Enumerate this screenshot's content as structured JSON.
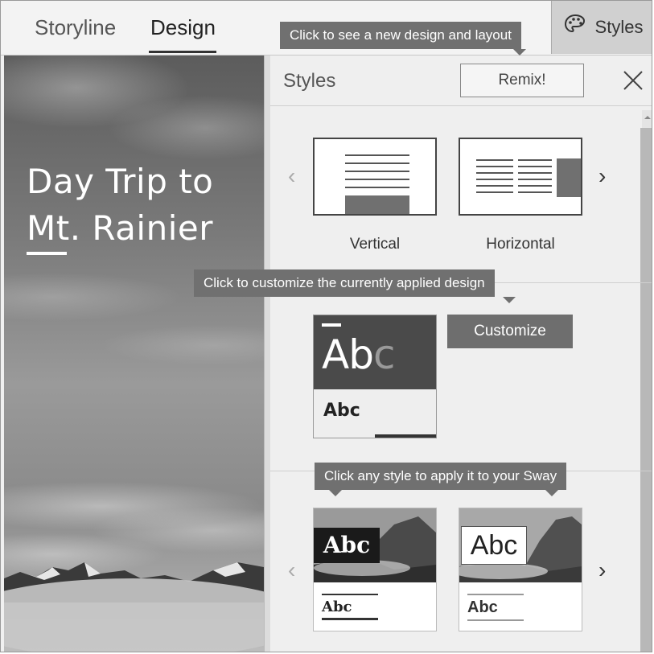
{
  "tabs": {
    "storyline": "Storyline",
    "design": "Design"
  },
  "styles_button": {
    "label": "Styles",
    "icon": "palette-icon"
  },
  "story": {
    "title_line1": "Day Trip to",
    "title_line2": "Mt. Rainier"
  },
  "pane": {
    "title": "Styles",
    "remix_label": "Remix!",
    "close_icon": "close-icon",
    "tooltip_remix": "Click to see a new design and layout",
    "layouts": [
      {
        "label": "Vertical"
      },
      {
        "label": "Horizontal"
      }
    ],
    "tooltip_customize": "Click to customize the currently applied design",
    "design_preview": {
      "large": "Ab",
      "large_accent": "c",
      "small": "Abc"
    },
    "customize_label": "Customize",
    "tooltip_styles": "Click any style to apply it to your Sway",
    "style_cards": [
      {
        "large": "Abc",
        "small": "Abc"
      },
      {
        "large": "Abc",
        "small": "Abc"
      }
    ],
    "nav": {
      "prev": "‹",
      "next": "›"
    }
  },
  "colors": {
    "tooltip": "#707070",
    "customize": "#6e6e6e",
    "styles_button_bg": "#d0d0d0"
  }
}
